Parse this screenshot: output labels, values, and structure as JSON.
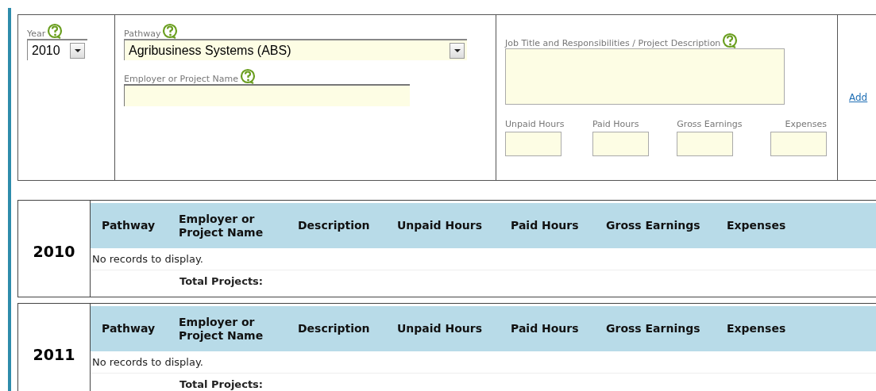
{
  "form": {
    "year": {
      "label": "Year",
      "value": "2010"
    },
    "pathway": {
      "label": "Pathway",
      "value": "Agribusiness Systems (ABS)"
    },
    "employer": {
      "label": "Employer or Project Name"
    },
    "description": {
      "label": "Job Title and Responsibilities / Project Description"
    },
    "amounts": [
      {
        "label": "Unpaid Hours"
      },
      {
        "label": "Paid Hours"
      },
      {
        "label": "Gross Earnings"
      },
      {
        "label": "Expenses"
      }
    ],
    "add_link": "Add"
  },
  "year_tables": [
    {
      "year": "2010",
      "columns": [
        "Pathway",
        "Employer or Project Name",
        "Description",
        "Unpaid Hours",
        "Paid Hours",
        "Gross Earnings",
        "Expenses"
      ],
      "empty_message": "No records to display.",
      "total_label": "Total Projects:"
    },
    {
      "year": "2011",
      "columns": [
        "Pathway",
        "Employer or Project Name",
        "Description",
        "Unpaid Hours",
        "Paid Hours",
        "Gross Earnings",
        "Expenses"
      ],
      "empty_message": "No records to display.",
      "total_label": "Total Projects:"
    }
  ]
}
